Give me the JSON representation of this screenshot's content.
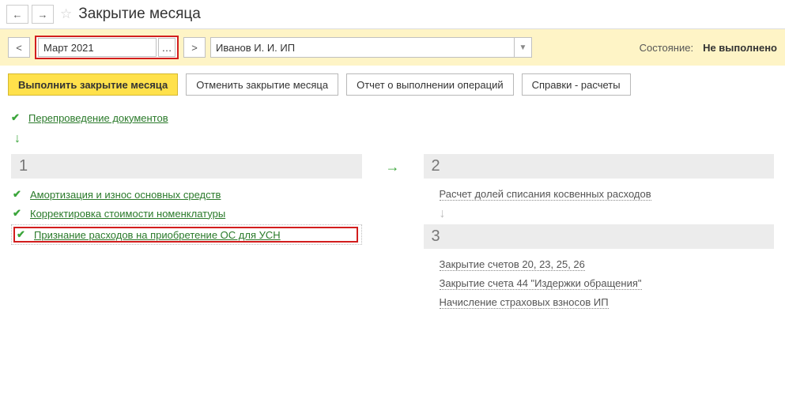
{
  "header": {
    "title": "Закрытие месяца"
  },
  "period": {
    "value": "Март 2021"
  },
  "org": {
    "value": "Иванов И. И. ИП"
  },
  "status": {
    "label": "Состояние:",
    "value": "Не выполнено"
  },
  "actions": {
    "execute": "Выполнить закрытие месяца",
    "cancel": "Отменить закрытие месяца",
    "report": "Отчет о выполнении операций",
    "refs": "Справки - расчеты"
  },
  "pre_op": {
    "label": "Перепроведение документов"
  },
  "steps": {
    "s1": "1",
    "s2": "2",
    "s3": "3"
  },
  "col1": {
    "op1": "Амортизация и износ основных средств",
    "op2": "Корректировка стоимости номенклатуры",
    "op3": "Признание расходов на приобретение ОС для УСН"
  },
  "col2": {
    "op1": "Расчет долей списания косвенных расходов",
    "op2": "Закрытие счетов 20, 23, 25, 26",
    "op3": "Закрытие счета 44 \"Издержки обращения\"",
    "op4": "Начисление страховых взносов ИП"
  }
}
